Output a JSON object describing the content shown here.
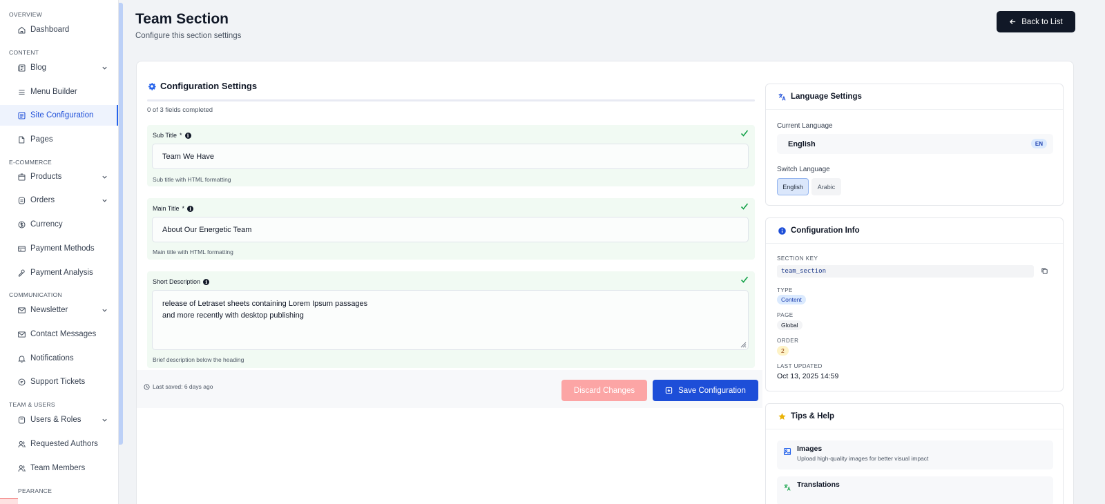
{
  "sidebar": {
    "sections": {
      "overview": "OVERVIEW",
      "content": "CONTENT",
      "ecommerce": "E-COMMERCE",
      "communication": "COMMUNICATION",
      "team_users": "TEAM & USERS",
      "appearance": "PEARANCE"
    },
    "items": {
      "dashboard": "Dashboard",
      "blog": "Blog",
      "menu_builder": "Menu Builder",
      "site_configuration": "Site Configuration",
      "pages": "Pages",
      "products": "Products",
      "orders": "Orders",
      "currency": "Currency",
      "payment_methods": "Payment Methods",
      "payment_analysis": "Payment Analysis",
      "newsletter": "Newsletter",
      "contact_messages": "Contact Messages",
      "notifications": "Notifications",
      "support_tickets": "Support Tickets",
      "users_roles": "Users & Roles",
      "requested_authors": "Requested Authors",
      "team_members": "Team Members"
    },
    "active_item": "site_configuration"
  },
  "header": {
    "title": "Team Section",
    "subtitle": "Configure this section settings",
    "back_button": "Back to List"
  },
  "form": {
    "title": "Configuration Settings",
    "progress_text": "0 of 3 fields completed",
    "progress_fraction": 0,
    "fields": [
      {
        "label": "Sub Title",
        "required_mark": "*",
        "value": "Team We Have",
        "hint": "Sub title with HTML formatting"
      },
      {
        "label": "Main Title",
        "required_mark": "*",
        "value": "About Our Energetic Team",
        "hint": "Main title with HTML formatting"
      },
      {
        "label": "Short Description",
        "value": "release of Letraset sheets containing Lorem Ipsum passages\nand more recently with desktop publishing",
        "hint": "Brief description below the heading"
      }
    ],
    "last_saved": "Last saved: 6 days ago",
    "discard_button": "Discard Changes",
    "save_button": "Save Configuration"
  },
  "language": {
    "title": "Language Settings",
    "current_label": "Current Language",
    "current_value": "English",
    "current_code": "EN",
    "switch_label": "Switch Language",
    "options": [
      "English",
      "Arabic"
    ],
    "selected": "English"
  },
  "config_info": {
    "title": "Configuration Info",
    "section_key_label": "SECTION KEY",
    "section_key": "team_section",
    "type_label": "TYPE",
    "type": "Content",
    "page_label": "PAGE",
    "page": "Global",
    "order_label": "ORDER",
    "order": "2",
    "updated_label": "LAST UPDATED",
    "updated": "Oct 13, 2025 14:59"
  },
  "tips": {
    "title": "Tips & Help",
    "items": [
      {
        "title": "Images",
        "desc": "Upload high-quality images for better visual impact"
      },
      {
        "title": "Translations",
        "desc": ""
      }
    ]
  },
  "colors": {
    "accent": "#1d4ed8",
    "success": "#16a34a",
    "danger_light": "#fca5a5",
    "dark_button": "#111827"
  }
}
